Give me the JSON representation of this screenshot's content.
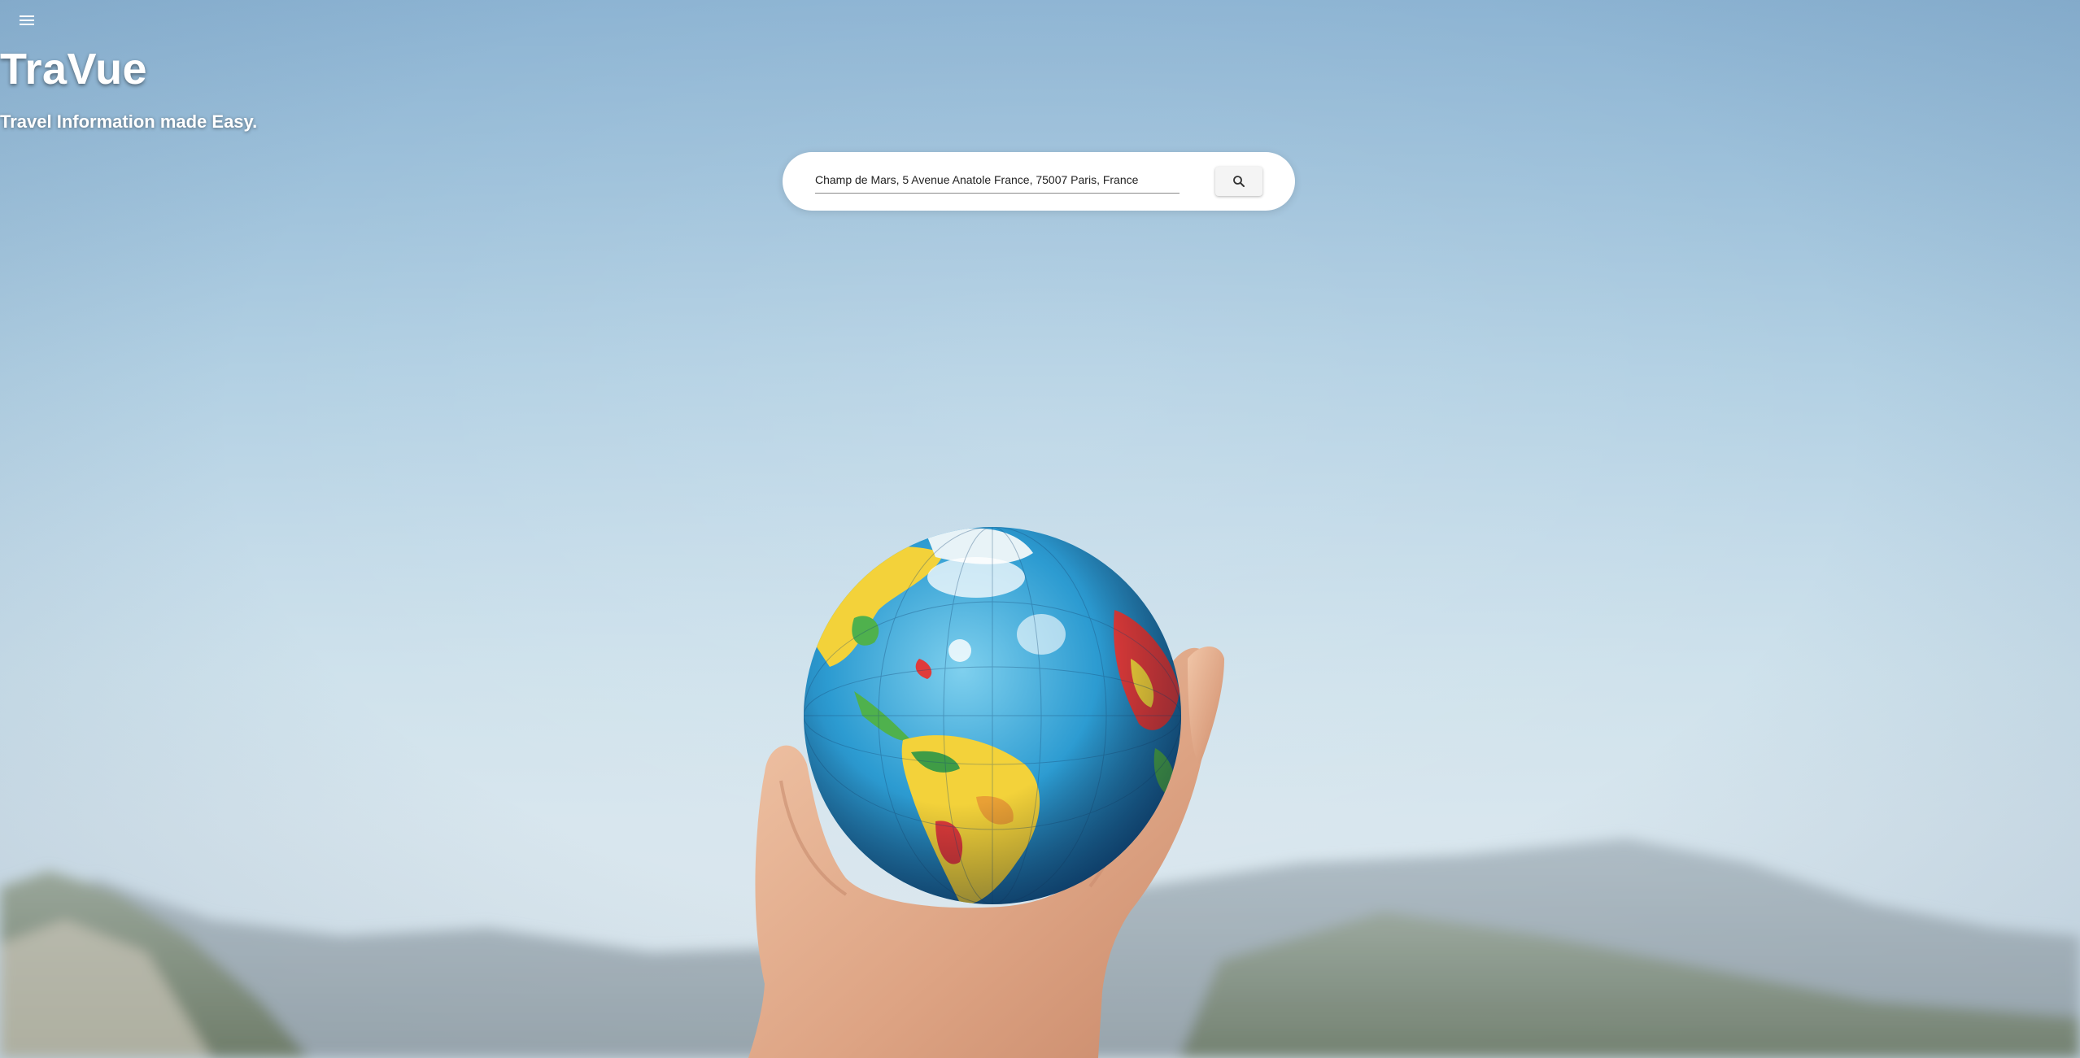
{
  "header": {
    "menu_icon": "menu-icon"
  },
  "hero": {
    "title": "TraVue",
    "tagline": "Travel Information made Easy."
  },
  "search": {
    "value": "Champ de Mars, 5 Avenue Anatole France, 75007 Paris, France",
    "button_icon": "search-icon"
  },
  "background": {
    "image": "hand-holding-globe-photo",
    "sky_color": "#a9c9df"
  }
}
